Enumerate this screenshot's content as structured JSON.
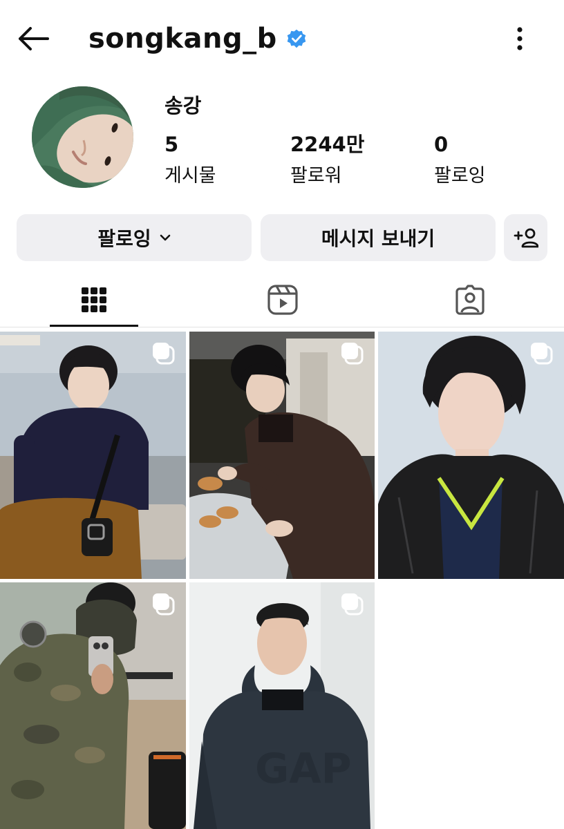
{
  "header": {
    "username": "songkang_b",
    "verified": true,
    "back_icon": "arrow-left-icon",
    "more_icon": "vertical-ellipsis-icon"
  },
  "profile": {
    "display_name": "송강",
    "stats": [
      {
        "value": "5",
        "label": "게시물"
      },
      {
        "value": "2244만",
        "label": "팔로워"
      },
      {
        "value": "0",
        "label": "팔로잉"
      }
    ]
  },
  "actions": {
    "following_label": "팔로잉",
    "message_label": "메시지 보내기",
    "add_user_icon": "add-user-icon"
  },
  "tabs": [
    {
      "name": "posts-grid",
      "icon": "grid-icon",
      "active": true
    },
    {
      "name": "reels",
      "icon": "reels-icon",
      "active": false
    },
    {
      "name": "tagged",
      "icon": "tagged-person-icon",
      "active": false
    }
  ],
  "posts": [
    {
      "type": "carousel",
      "icon": "multiple-images-icon"
    },
    {
      "type": "carousel",
      "icon": "multiple-images-icon"
    },
    {
      "type": "carousel",
      "icon": "multiple-images-icon"
    },
    {
      "type": "carousel",
      "icon": "multiple-images-icon"
    },
    {
      "type": "carousel",
      "icon": "multiple-images-icon"
    }
  ],
  "colors": {
    "verified_badge": "#3897f0",
    "button_bg": "#efeff2",
    "text": "#111111"
  }
}
